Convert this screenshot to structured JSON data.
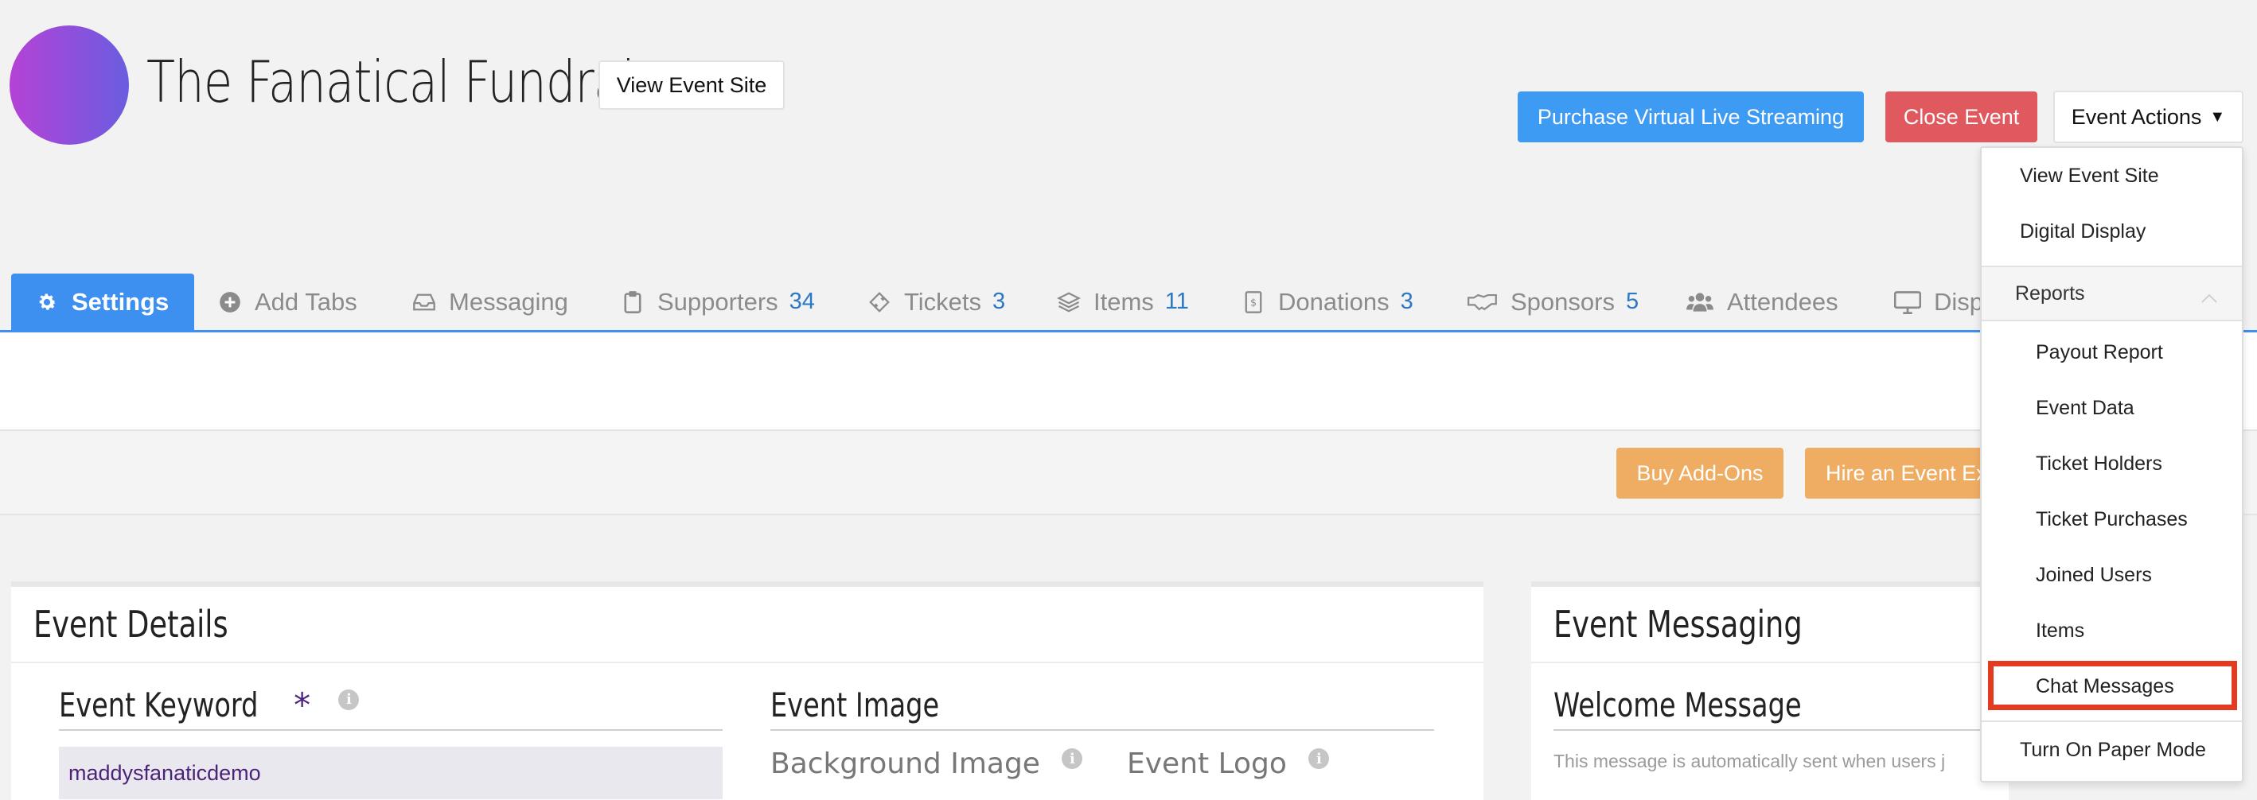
{
  "header": {
    "title": "The Fanatical Fundraiser",
    "view_event_site": "View Event Site",
    "purchase_streaming": "Purchase Virtual Live Streaming",
    "close_event": "Close Event",
    "event_actions": "Event Actions"
  },
  "tabs": [
    {
      "label": "Settings",
      "count": "",
      "icon": "gear-icon",
      "active": true
    },
    {
      "label": "Add Tabs",
      "count": "",
      "icon": "plus-circle-icon"
    },
    {
      "label": "Messaging",
      "count": "",
      "icon": "inbox-icon"
    },
    {
      "label": "Supporters",
      "count": "34",
      "icon": "clipboard-icon"
    },
    {
      "label": "Tickets",
      "count": "3",
      "icon": "ticket-icon"
    },
    {
      "label": "Items",
      "count": "11",
      "icon": "layers-icon"
    },
    {
      "label": "Donations",
      "count": "3",
      "icon": "donation-icon"
    },
    {
      "label": "Sponsors",
      "count": "5",
      "icon": "handshake-icon"
    },
    {
      "label": "Attendees",
      "count": "",
      "icon": "users-icon"
    },
    {
      "label": "Displ",
      "count": "",
      "icon": "monitor-icon"
    }
  ],
  "toolbar": {
    "buy_addons": "Buy Add-Ons",
    "hire_expert": "Hire an Event Ex"
  },
  "event_details": {
    "heading": "Event Details",
    "keyword_label": "Event Keyword",
    "required_mark": "*",
    "keyword_value": "maddysfanaticdemo",
    "image_heading": "Event Image",
    "background_image": "Background Image",
    "event_logo": "Event Logo"
  },
  "event_messaging": {
    "heading": "Event Messaging",
    "welcome_heading": "Welcome Message",
    "helper": "This message is automatically sent when users j"
  },
  "dropdown": {
    "items_top": [
      "View Event Site",
      "Digital Display"
    ],
    "group_label": "Reports",
    "reports": [
      "Payout Report",
      "Event Data",
      "Ticket Holders",
      "Ticket Purchases",
      "Joined Users",
      "Items",
      "Chat Messages"
    ],
    "bottom_item": "Turn On Paper Mode",
    "highlighted": "Chat Messages"
  },
  "colors": {
    "primary_blue": "#3d8ff0",
    "close_red": "#e0595f",
    "addon_orange": "#efad63",
    "highlight_red": "#e23b20"
  }
}
